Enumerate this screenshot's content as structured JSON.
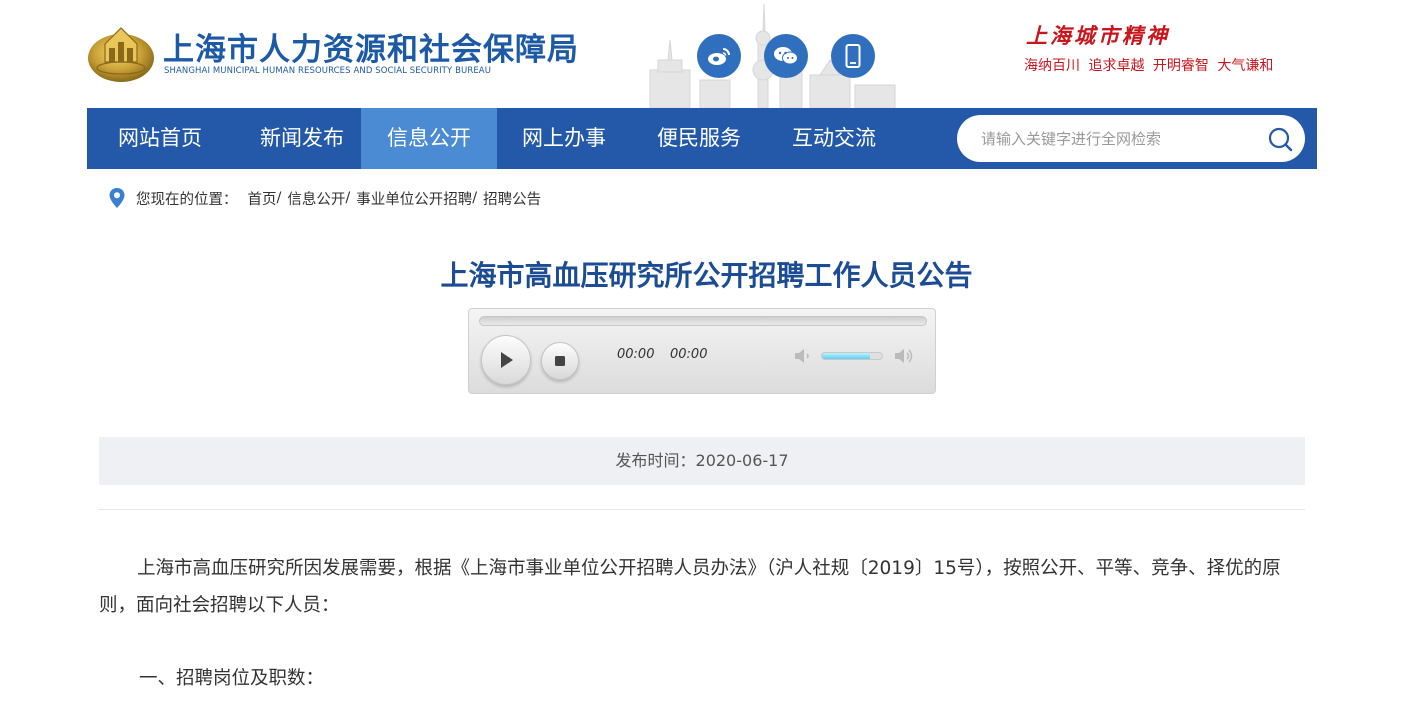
{
  "header": {
    "logo_title": "上海市人力资源和社会保障局",
    "logo_subtitle": "SHANGHAI MUNICIPAL HUMAN RESOURCES AND SOCIAL SECURITY BUREAU",
    "social_icons": [
      "weibo-icon",
      "wechat-icon",
      "mobile-icon"
    ],
    "spirit_title": "上海城市精神",
    "spirit_slogan": "海纳百川 追求卓越 开明睿智 大气谦和"
  },
  "nav": {
    "items": [
      {
        "label": "网站首页",
        "active": false
      },
      {
        "label": "新闻发布",
        "active": false
      },
      {
        "label": "信息公开",
        "active": true
      },
      {
        "label": "网上办事",
        "active": false
      },
      {
        "label": "便民服务",
        "active": false
      },
      {
        "label": "互动交流",
        "active": false
      }
    ],
    "search_placeholder": "请输入关键字进行全网检索"
  },
  "breadcrumb": {
    "label": "您现在的位置：",
    "items": [
      "首页",
      "信息公开",
      "事业单位公开招聘",
      "招聘公告"
    ],
    "separator": "/"
  },
  "article": {
    "title": "上海市高血压研究所公开招聘工作人员公告",
    "player": {
      "current_time": "00:00",
      "duration": "00:00",
      "volume": 0.8
    },
    "publish_label": "发布时间：",
    "publish_date": "2020-06-17",
    "paragraph_1": "上海市高血压研究所因发展需要，根据《上海市事业单位公开招聘人员办法》（沪人社规〔2019〕15号），按照公开、平等、竞争、择优的原则，面向社会招聘以下人员：",
    "section_1": "一、招聘岗位及职数："
  },
  "colors": {
    "brand_blue": "#1d5aa6",
    "nav_bg": "#2359a8",
    "nav_active": "#4a8bd4",
    "title_blue": "#1b4c94",
    "spirit_red": "#c8161d"
  }
}
